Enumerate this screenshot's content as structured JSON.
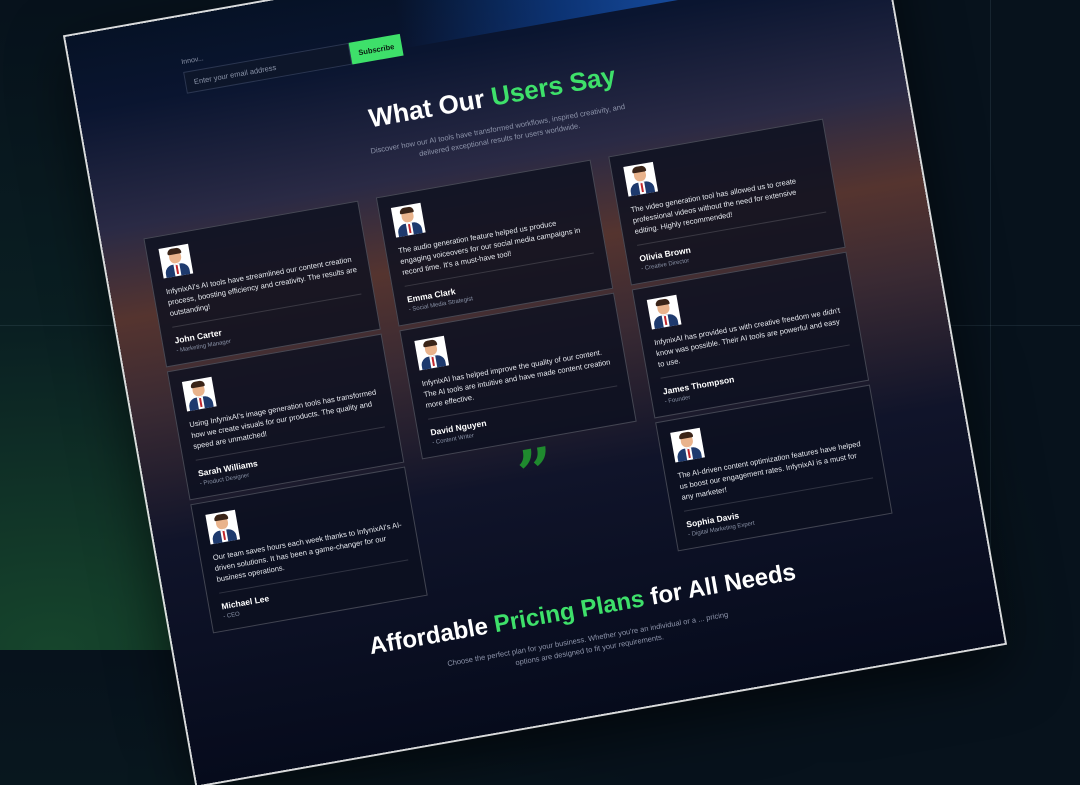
{
  "newsletter": {
    "intro": "Innov...",
    "email_placeholder": "Enter your email address",
    "subscribe_label": "Subscribe"
  },
  "testimonials": {
    "title_prefix": "What Our ",
    "title_accent": "Users Say",
    "subtitle": "Discover how our AI tools have transformed workflows, inspired creativity, and delivered exceptional results for users worldwide.",
    "quote_icon": "quote-mark-icon",
    "quote_glyph": "”",
    "cards": [
      {
        "quote": "InfynixAI's AI tools have streamlined our content creation process, boosting efficiency and creativity. The results are outstanding!",
        "name": "John Carter",
        "role": "- Marketing Manager"
      },
      {
        "quote": "The audio generation feature helped us produce engaging voiceovers for our social media campaigns in record time. It's a must-have tool!",
        "name": "Emma Clark",
        "role": "- Social Media Strategist"
      },
      {
        "quote": "The video generation tool has allowed us to create professional videos without the need for extensive editing. Highly recommended!",
        "name": "Olivia Brown",
        "role": "- Creative Director"
      },
      {
        "quote": "Using InfynixAI's image generation tools has transformed how we create visuals for our products. The quality and speed are unmatched!",
        "name": "Sarah Williams",
        "role": "- Product Designer"
      },
      {
        "quote": "InfynixAI has helped improve the quality of our content. The AI tools are intuitive and have made content creation more effective.",
        "name": "David Nguyen",
        "role": "- Content Writer"
      },
      {
        "quote": "InfynixAI has provided us with creative freedom we didn't know was possible. Their AI tools are powerful and easy to use.",
        "name": "James Thompson",
        "role": "- Founder"
      },
      {
        "quote": "Our team saves hours each week thanks to InfynixAI's AI-driven solutions. It has been a game-changer for our business operations.",
        "name": "Michael Lee",
        "role": "- CEO"
      },
      {
        "quote": "The AI-driven content optimization features have helped us boost our engagement rates. InfynixAI is a must for any marketer!",
        "name": "Sophia Davis",
        "role": "- Digital Marketing Expert"
      }
    ]
  },
  "pricing": {
    "title_prefix": "Affordable ",
    "title_accent": "Pricing Plans",
    "title_suffix": " for All Needs",
    "subtitle": "Choose the perfect plan for your business. Whether you're an individual or a ... pricing options are designed to fit your requirements."
  },
  "colors": {
    "accent": "#3ee06a",
    "card_border": "#ffffff",
    "background": "#07121c"
  }
}
